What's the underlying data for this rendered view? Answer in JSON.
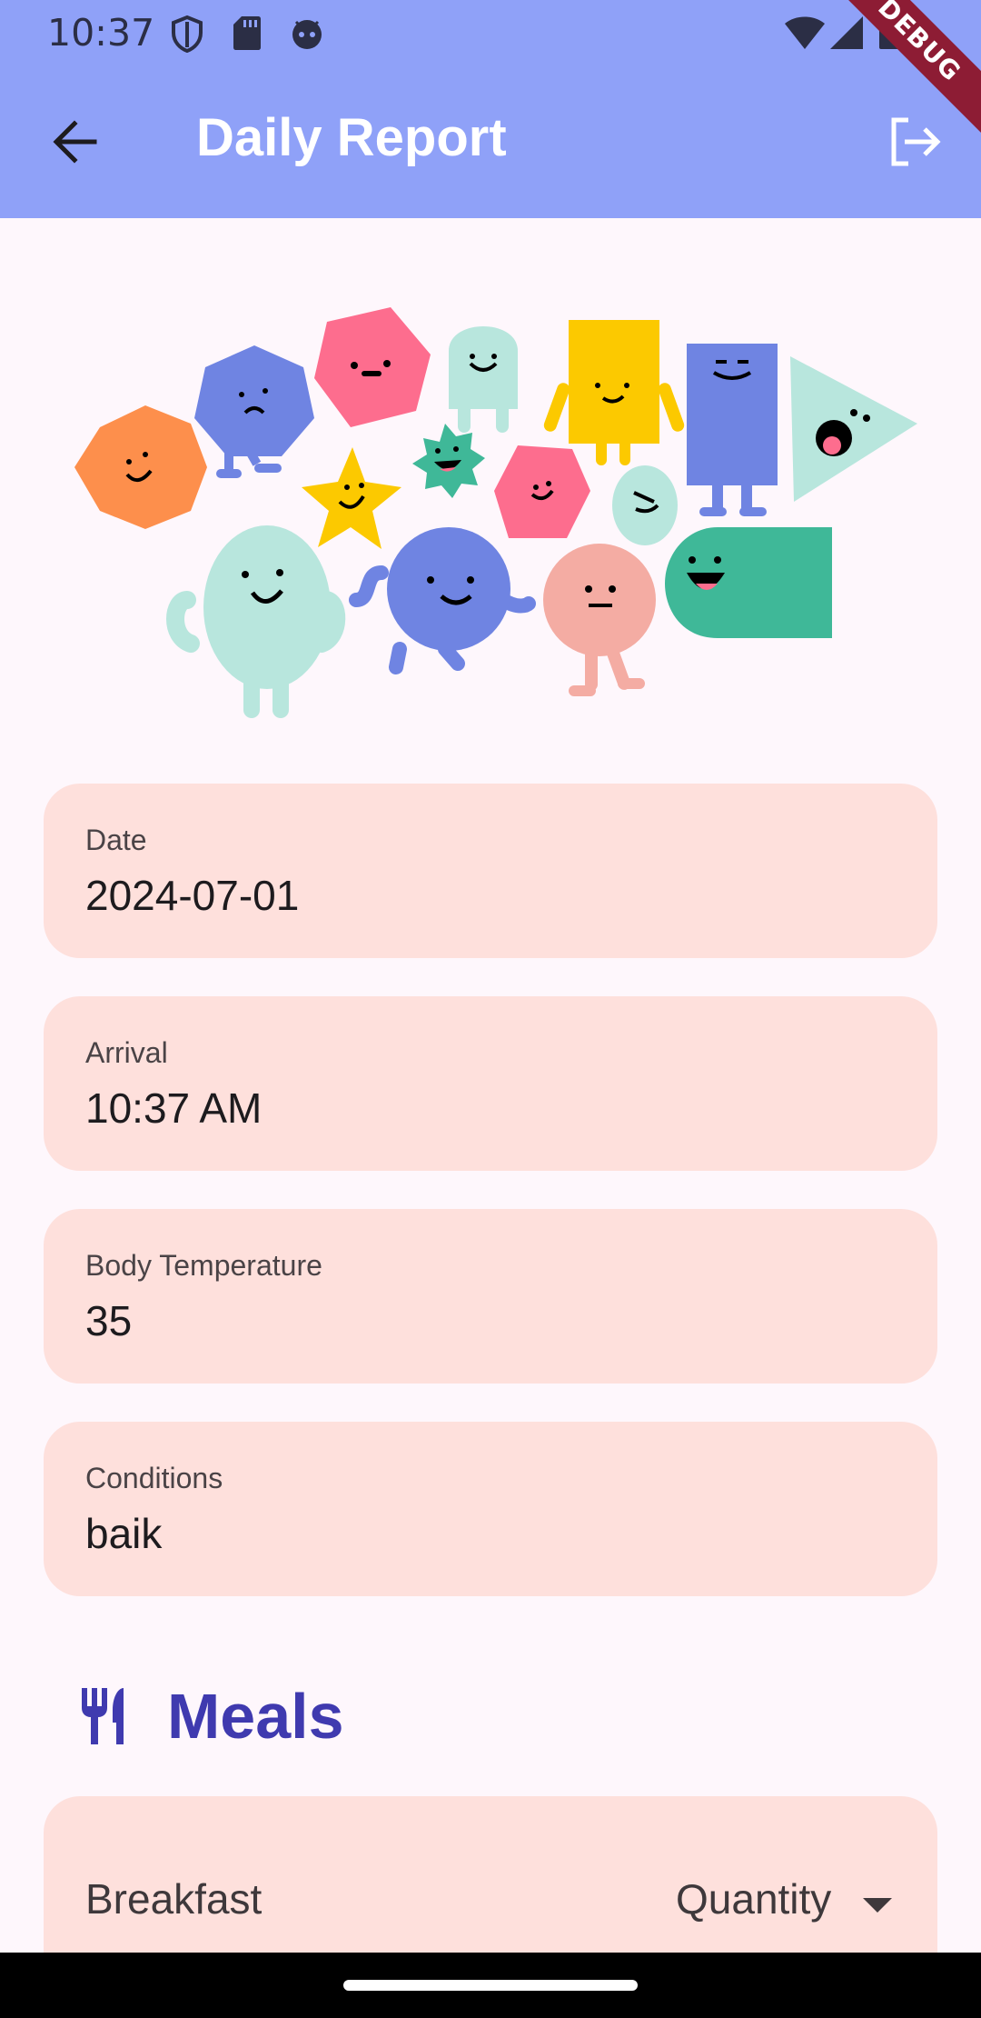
{
  "status_bar": {
    "time": "10:37"
  },
  "app_bar": {
    "title": "Daily Report"
  },
  "debug_label": "DEBUG",
  "fields": [
    {
      "label": "Date",
      "value": "2024-07-01"
    },
    {
      "label": "Arrival",
      "value": "10:37 AM"
    },
    {
      "label": "Body Temperature",
      "value": "35"
    },
    {
      "label": "Conditions",
      "value": "baik"
    }
  ],
  "meals": {
    "title": "Meals",
    "icon": "restaurant-icon",
    "breakfast_label": "Breakfast",
    "quantity_placeholder": "Quantity"
  },
  "colors": {
    "app_bar": "#8fa1f8",
    "card": "#fee0dc",
    "section_title": "#3f3aaf",
    "background": "#fef7fc"
  }
}
